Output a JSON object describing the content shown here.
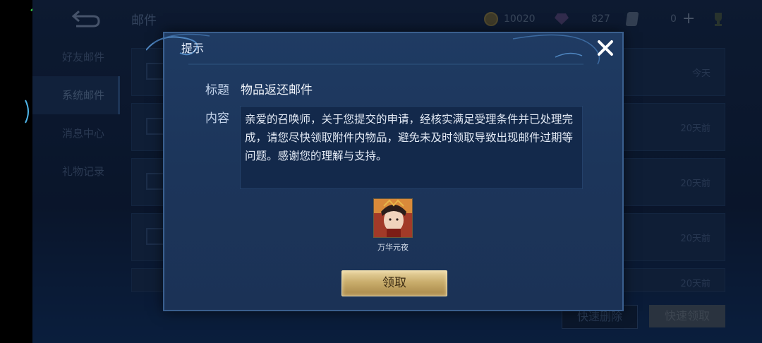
{
  "status": {
    "wifi_icon": "wifi-icon"
  },
  "header": {
    "back_icon": "back-arrow-icon",
    "title": "邮件",
    "coins": "10020",
    "diamonds": "827",
    "tickets": "0"
  },
  "sidebar": {
    "items": [
      {
        "label": "好友邮件"
      },
      {
        "label": "系统邮件"
      },
      {
        "label": "消息中心"
      },
      {
        "label": "礼物记录"
      }
    ]
  },
  "mail_list": {
    "rows": [
      {
        "time": "今天"
      },
      {
        "time": "20天前"
      },
      {
        "time": "20天前"
      },
      {
        "time": "20天前"
      },
      {
        "time": "20天前"
      }
    ]
  },
  "actions": {
    "quick_delete": "快速删除",
    "quick_claim": "快速领取"
  },
  "dialog": {
    "title": "提示",
    "subject_label": "标题",
    "subject": "物品返还邮件",
    "content_label": "内容",
    "content": "亲爱的召唤师，关于您提交的申请，经核实满足受理条件并已处理完成，请您尽快领取附件内物品，避免未及时领取导致出现邮件过期等问题。感谢您的理解与支持。",
    "reward": {
      "name": "万华元夜",
      "icon": "hero-skin-icon"
    },
    "claim_label": "领取"
  },
  "colors": {
    "dialog_bg": "#1f3b63",
    "claim_gold": "#c9ad6c",
    "accent_blue": "#3a5f8e"
  }
}
